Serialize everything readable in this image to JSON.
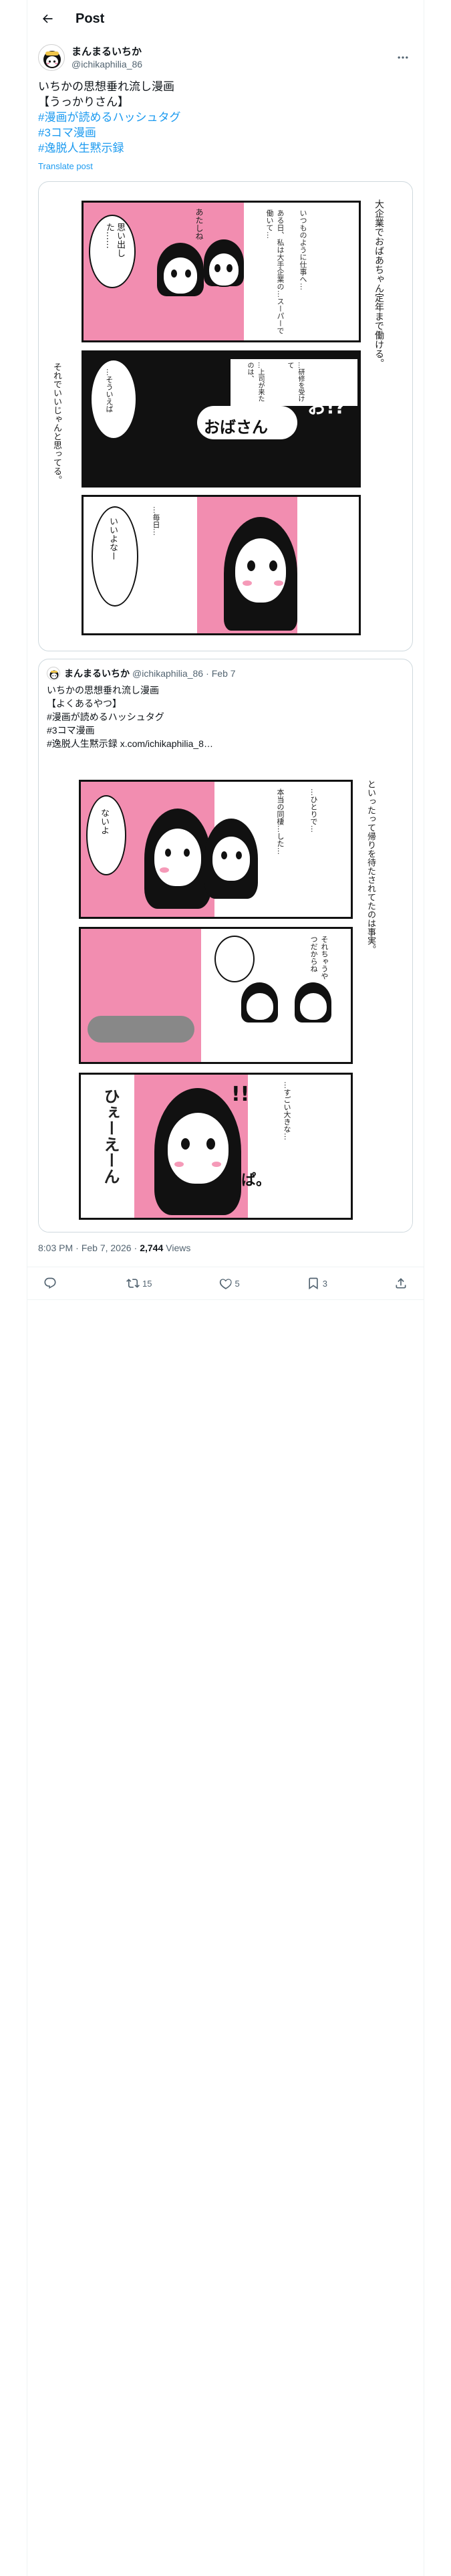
{
  "header": {
    "title": "Post"
  },
  "author": {
    "display_name": "まんまるいちか",
    "handle": "@ichikaphilia_86"
  },
  "post": {
    "lines": [
      "いちかの思想垂れ流し漫画",
      "【うっかりさん】"
    ],
    "hashtags": [
      "#漫画が読めるハッシュタグ",
      "#3コマ漫画",
      "#逸脱人生黙示録"
    ],
    "translate_label": "Translate post"
  },
  "quote": {
    "display_name": "まんまるいちか",
    "handle": "@ichikaphilia_86",
    "date": "Feb 7",
    "lines": [
      "いちかの思想垂れ流し漫画",
      "【よくあるやつ】",
      "#漫画が読めるハッシュタグ",
      "#3コマ漫画"
    ],
    "last_line_tag": "#逸脱人生黙示録",
    "last_line_link": "x.com/ichikaphilia_8…"
  },
  "meta": {
    "time": "8:03 PM",
    "date": "Feb 7, 2026",
    "views_count": "2,744",
    "views_label": "Views"
  },
  "actions": {
    "reply_count": "",
    "repost_count": "15",
    "like_count": "5",
    "bookmark_count": "3"
  },
  "manga1": {
    "p1_right": "大企業でおばあちゃん定年まで働ける。",
    "p1_speech1": "あ、たし……",
    "p1_speech2": "思い出した……",
    "p1_speech3": "あたしね",
    "p2_banner": "おばさん",
    "p2_shout": "お!?",
    "p2_left": "それでいいじゃんと思ってる。",
    "p3_speech": "いいよなー"
  },
  "manga2": {
    "p1_right": "といったって帰りを待たされてたのは事実。",
    "p1_speech": "ないよ",
    "p2_speech": "それちゃうやつだからね",
    "p3_big": "ひぇーえーん",
    "p3_small": "!!",
    "p3_pa": "ぱ。"
  },
  "colors": {
    "accent": "#1d9bf0",
    "muted": "#536471",
    "border": "#cfd9de",
    "manga_pink": "#f28db0"
  }
}
